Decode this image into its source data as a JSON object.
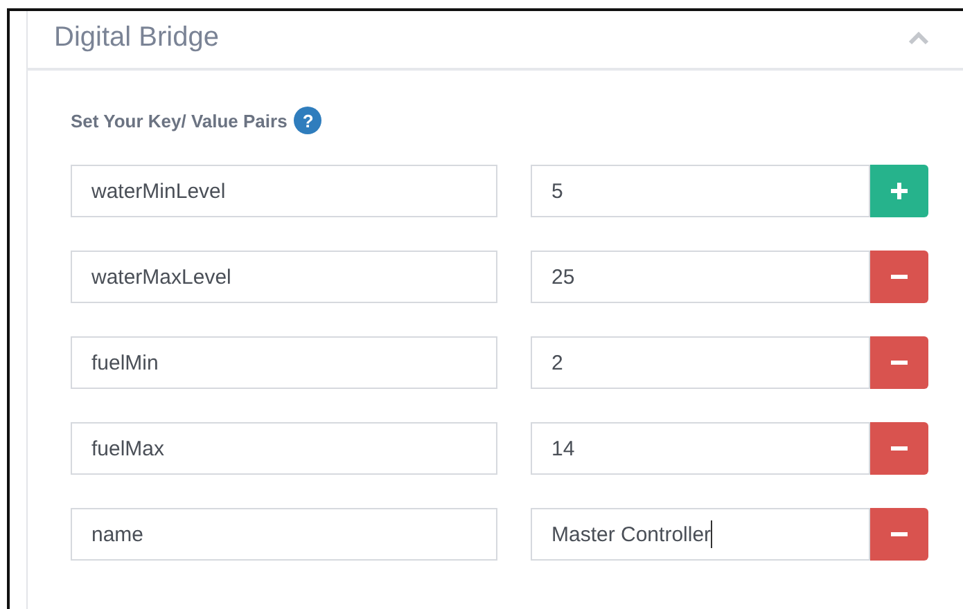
{
  "panel": {
    "title": "Digital Bridge",
    "expanded": true
  },
  "section": {
    "label": "Set Your Key/ Value Pairs",
    "help": "?"
  },
  "pairs": [
    {
      "key": "waterMinLevel",
      "value": "5",
      "kind": "add",
      "focused": false
    },
    {
      "key": "waterMaxLevel",
      "value": "25",
      "kind": "remove",
      "focused": false
    },
    {
      "key": "fuelMin",
      "value": "2",
      "kind": "remove",
      "focused": false
    },
    {
      "key": "fuelMax",
      "value": "14",
      "kind": "remove",
      "focused": false
    },
    {
      "key": "name",
      "value": "Master Controller",
      "kind": "remove",
      "focused": true
    }
  ]
}
